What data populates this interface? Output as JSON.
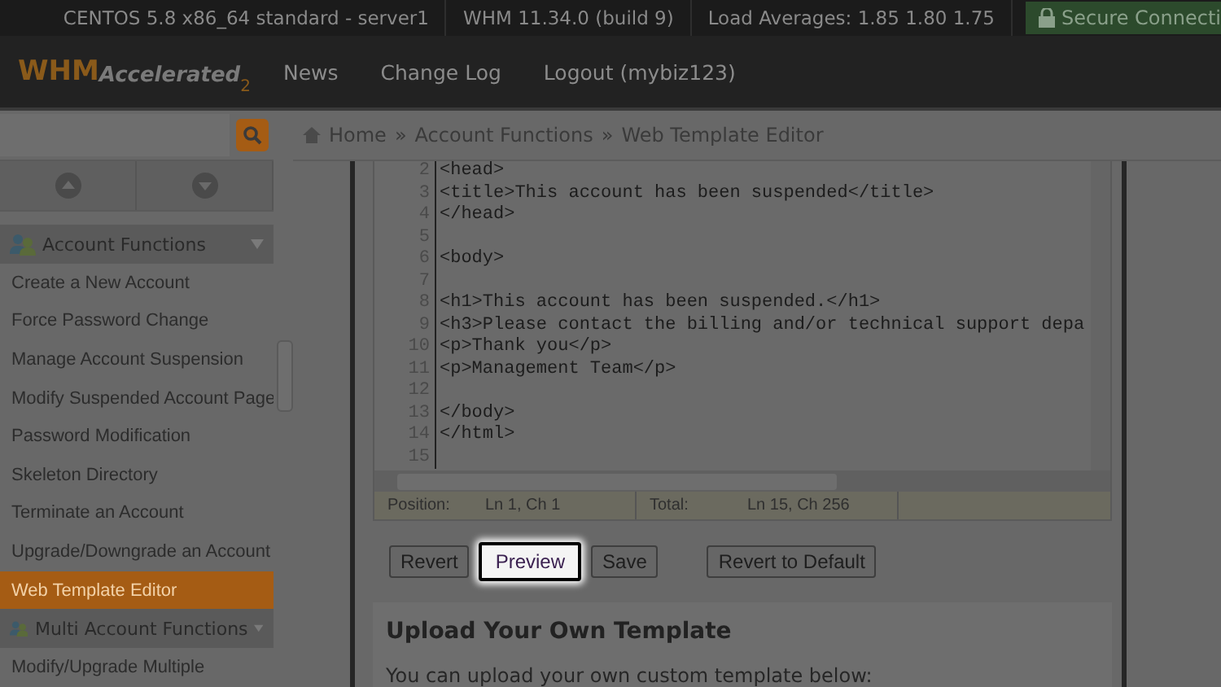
{
  "top_bar": {
    "items": [
      "CENTOS 5.8 x86_64 standard - server1",
      "WHM 11.34.0 (build 9)",
      "Load Averages: 1.85 1.80 1.75"
    ],
    "secure": "Secure Connecti"
  },
  "logo": {
    "word": "WHM",
    "script": "Accelerated",
    "version": "2"
  },
  "nav": [
    "News",
    "Change Log",
    "Logout (mybiz123)"
  ],
  "sidebar": {
    "sections": [
      {
        "title": "Account Functions",
        "items": [
          {
            "label": "Create a New Account",
            "selected": false
          },
          {
            "label": "Force Password Change",
            "selected": false
          },
          {
            "label": "Manage Account Suspension",
            "selected": false
          },
          {
            "label": "Modify Suspended Account Page",
            "selected": false
          },
          {
            "label": "Password Modification",
            "selected": false
          },
          {
            "label": "Skeleton Directory",
            "selected": false
          },
          {
            "label": "Terminate an Account",
            "selected": false
          },
          {
            "label": "Upgrade/Downgrade an Account",
            "selected": false
          },
          {
            "label": "Web Template Editor",
            "selected": true
          }
        ]
      },
      {
        "title": "Multi Account Functions",
        "items": [
          {
            "label": "Modify/Upgrade Multiple",
            "selected": false
          }
        ]
      }
    ]
  },
  "breadcrumb": {
    "items": [
      "Home",
      "Account Functions",
      "Web Template Editor"
    ],
    "separators": [
      "»",
      "»"
    ]
  },
  "editor": {
    "lines": [
      {
        "number": "2",
        "code": "<head>"
      },
      {
        "number": "3",
        "code": "<title>This account has been suspended</title>"
      },
      {
        "number": "4",
        "code": "</head>"
      },
      {
        "number": "5"
      },
      {
        "number": "6",
        "code": "<body>"
      },
      {
        "number": "7"
      },
      {
        "number": "8",
        "code": "<h1>This account has been suspended.</h1>"
      },
      {
        "number": "9",
        "code": "<h3>Please contact the billing and/or technical support depa"
      },
      {
        "number": "10",
        "code": "<p>Thank you</p>"
      },
      {
        "number": "11",
        "code": "<p>Management Team</p>"
      },
      {
        "number": "12"
      },
      {
        "number": "13",
        "code": "</body>"
      },
      {
        "number": "14",
        "code": "</html>"
      },
      {
        "number": "15"
      }
    ],
    "status": {
      "position_label": "Position:",
      "position": "Ln 1, Ch 1",
      "total_label": "Total:",
      "total": "Ln 15, Ch 256"
    }
  },
  "buttons": [
    {
      "label": "Revert",
      "focused": false
    },
    {
      "label": "Preview",
      "focused": true
    },
    {
      "label": "Save",
      "focused": false
    },
    {
      "label": "Revert to Default",
      "focused": false
    }
  ],
  "upload": {
    "title": "Upload Your Own Template",
    "text": "You can upload your own custom template below:"
  }
}
